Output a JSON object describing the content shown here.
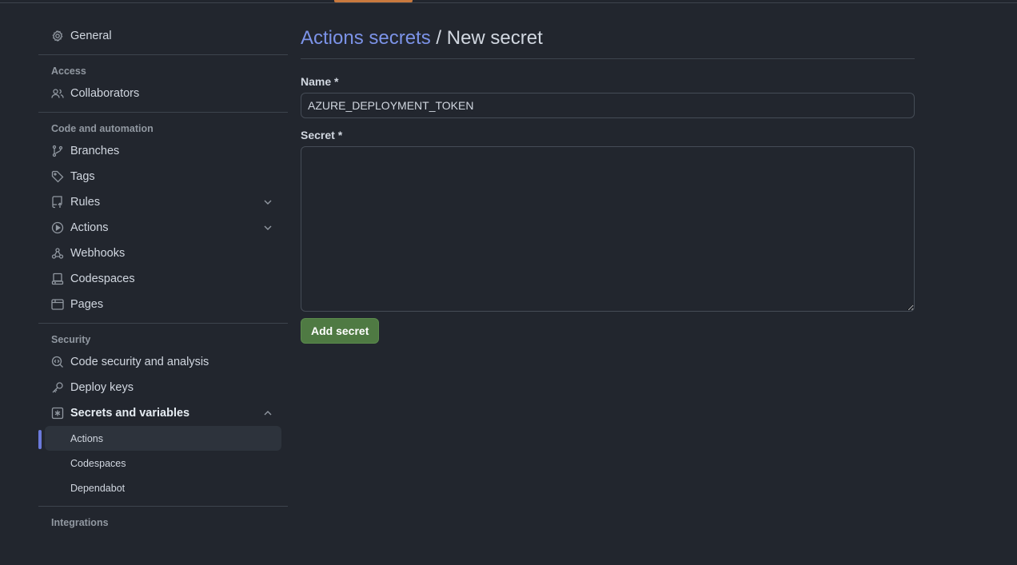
{
  "colors": {
    "background": "#22262e",
    "link": "#7c93e8",
    "accent_bar": "#6b7adb",
    "primary_button": "#4f7a43",
    "tab_indicator": "#c9793e"
  },
  "sidebar": {
    "general": {
      "label": "General",
      "icon": "gear-icon"
    },
    "access": {
      "title": "Access",
      "items": [
        {
          "label": "Collaborators",
          "icon": "people-icon"
        }
      ]
    },
    "code_automation": {
      "title": "Code and automation",
      "items": [
        {
          "label": "Branches",
          "icon": "git-branch-icon"
        },
        {
          "label": "Tags",
          "icon": "tag-icon"
        },
        {
          "label": "Rules",
          "icon": "repo-push-icon"
        },
        {
          "label": "Actions",
          "icon": "play-icon"
        },
        {
          "label": "Webhooks",
          "icon": "webhook-icon"
        },
        {
          "label": "Codespaces",
          "icon": "codespaces-icon"
        },
        {
          "label": "Pages",
          "icon": "browser-icon"
        }
      ]
    },
    "security": {
      "title": "Security",
      "items": [
        {
          "label": "Code security and analysis",
          "icon": "codescan-icon"
        },
        {
          "label": "Deploy keys",
          "icon": "key-icon"
        },
        {
          "label": "Secrets and variables",
          "icon": "key-asterisk-icon"
        }
      ],
      "sub_items": [
        {
          "label": "Actions"
        },
        {
          "label": "Codespaces"
        },
        {
          "label": "Dependabot"
        }
      ]
    },
    "integrations": {
      "title": "Integrations"
    }
  },
  "main": {
    "breadcrumb_link": "Actions secrets",
    "breadcrumb_separator": " / ",
    "title": "New secret",
    "name_label": "Name *",
    "name_value": "AZURE_DEPLOYMENT_TOKEN",
    "secret_label": "Secret *",
    "secret_value": "",
    "submit_label": "Add secret"
  }
}
